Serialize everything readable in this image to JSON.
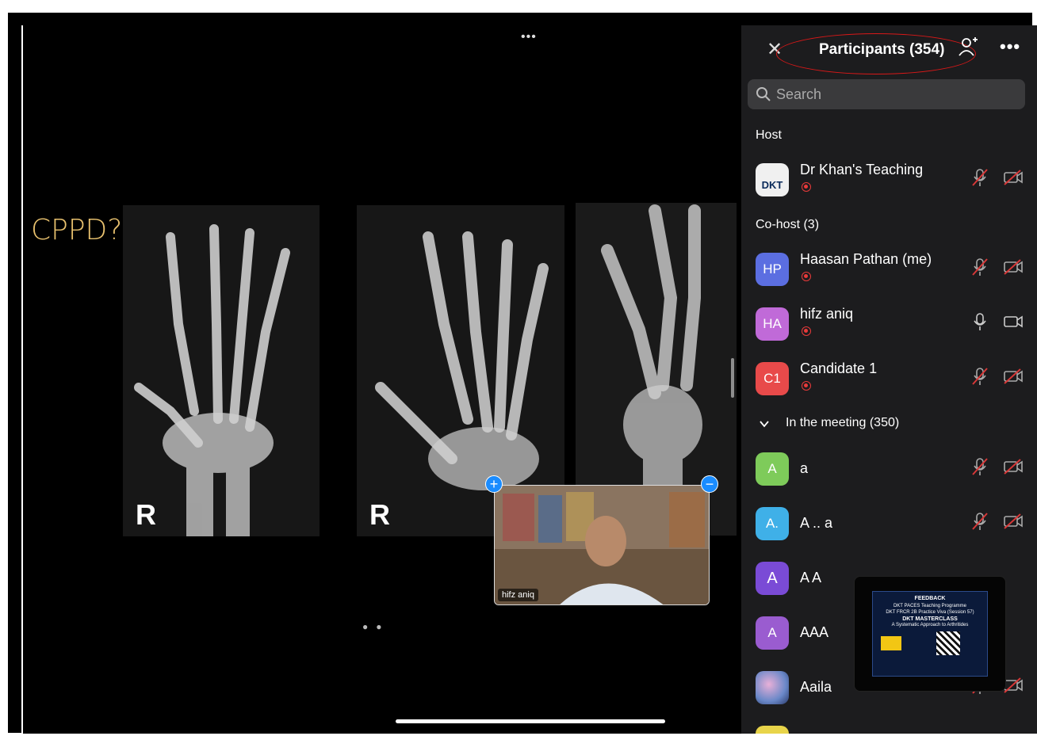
{
  "stage": {
    "slide_title": "CPPD?",
    "xray_labels": [
      "R",
      "R"
    ],
    "video_tile_name": "hifz aniq"
  },
  "panel": {
    "title": "Participants (354)",
    "search_placeholder": "Search",
    "sections": {
      "host": "Host",
      "cohost": "Co-host (3)",
      "meeting": "In the meeting (350)"
    },
    "host": [
      {
        "name": "Dr Khan's Teaching",
        "initials": "DKT",
        "avatar_color": "#f0f0f0",
        "recording": true,
        "muted": true,
        "video_off": true
      }
    ],
    "cohosts": [
      {
        "name": "Haasan Pathan (me)",
        "initials": "HP",
        "avatar_color": "#5b6ee1",
        "recording": true,
        "muted": true,
        "video_off": true
      },
      {
        "name": "hifz aniq",
        "initials": "HA",
        "avatar_color": "#c06ad8",
        "recording": true,
        "muted": false,
        "video_off": false
      },
      {
        "name": "Candidate 1",
        "initials": "C1",
        "avatar_color": "#e84a4a",
        "recording": true,
        "muted": true,
        "video_off": true
      }
    ],
    "attendees": [
      {
        "name": "a",
        "initials": "A",
        "avatar_color": "#7ecb5a",
        "muted": true,
        "video_off": true
      },
      {
        "name": "A .. a",
        "initials": "A.",
        "avatar_color": "#3fb0e8",
        "muted": true,
        "video_off": true
      },
      {
        "name": "A A",
        "initials": "A",
        "avatar_color": "#7a4bd6",
        "muted": true,
        "video_off": true
      },
      {
        "name": "AAA",
        "initials": "A",
        "avatar_color": "#9a5cd0",
        "muted": true,
        "video_off": true
      },
      {
        "name": "Aaila",
        "initials": "",
        "avatar_color": "#8aa0c8",
        "muted": true,
        "video_off": true
      }
    ]
  },
  "share_thumbnail": {
    "heading": "FEEDBACK",
    "line1": "DKT PACES Teaching Programme",
    "line2": "DKT FRCR 2B Practice Viva (Session 57)",
    "line3": "DKT MASTERCLASS",
    "line4": "A Systematic Approach to Arthritides"
  },
  "colors": {
    "accent_blue": "#1a8cff",
    "muted_red": "#d83838",
    "panel_bg": "#1c1c1e",
    "oval_red": "#d81818"
  }
}
